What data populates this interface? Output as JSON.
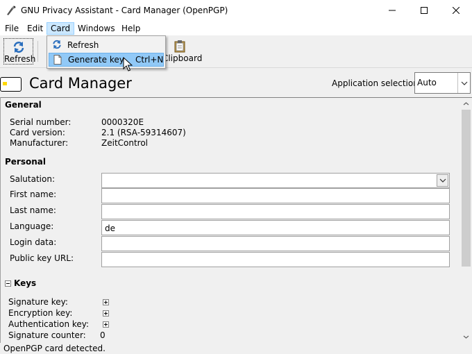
{
  "window": {
    "title": "GNU Privacy Assistant - Card Manager (OpenPGP)"
  },
  "menubar": {
    "file": "File",
    "edit": "Edit",
    "card": "Card",
    "windows": "Windows",
    "help": "Help"
  },
  "toolbar": {
    "refresh_label": "Refresh",
    "clipboard_label": "Clipboard"
  },
  "card_menu": {
    "items": [
      {
        "label": "Refresh",
        "shortcut": ""
      },
      {
        "label": "Generate key",
        "shortcut": "Ctrl+N"
      }
    ]
  },
  "header": {
    "title": "Card Manager",
    "app_selection_label": "Application selection:",
    "app_selection_value": "Auto"
  },
  "general": {
    "heading": "General",
    "serial_label": "Serial number:",
    "serial_value": "0000320E",
    "version_label": "Card version:",
    "version_value": "2.1  (RSA-59314607)",
    "manufacturer_label": "Manufacturer:",
    "manufacturer_value": "ZeitControl"
  },
  "personal": {
    "heading": "Personal",
    "salutation_label": "Salutation:",
    "salutation_value": "",
    "first_name_label": "First name:",
    "first_name_value": "",
    "last_name_label": "Last name:",
    "last_name_value": "",
    "language_label": "Language:",
    "language_value": "de",
    "login_label": "Login data:",
    "login_value": "",
    "url_label": "Public key URL:",
    "url_value": ""
  },
  "keys": {
    "heading": "Keys",
    "signature_label": "Signature key:",
    "encryption_label": "Encryption key:",
    "authentication_label": "Authentication key:",
    "counter_label": "Signature counter:",
    "counter_value": "0"
  },
  "status": {
    "text": "OpenPGP card detected."
  },
  "colors": {
    "menu_active_bg": "#cce8ff",
    "menu_highlight_bg": "#91c9f7",
    "chip_yellow": "#ffd800"
  }
}
